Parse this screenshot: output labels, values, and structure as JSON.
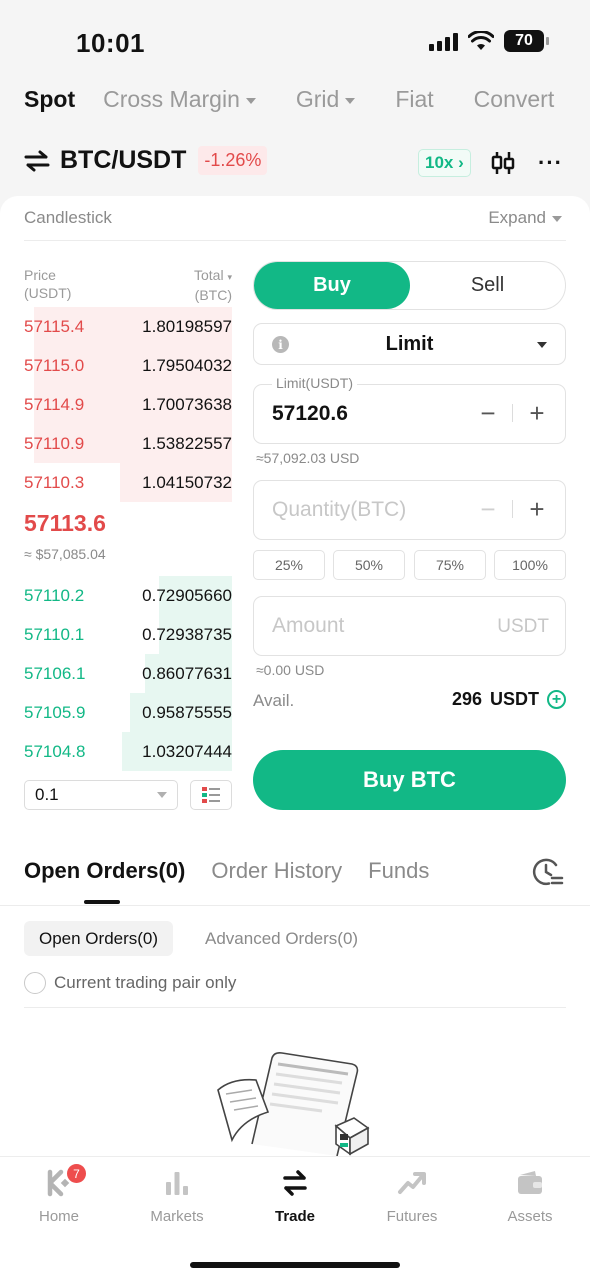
{
  "status_bar": {
    "time": "10:01",
    "battery": "70"
  },
  "trade_types": [
    {
      "label": "Spot"
    },
    {
      "label": "Cross Margin"
    },
    {
      "label": "Grid"
    },
    {
      "label": "Fiat"
    },
    {
      "label": "Convert"
    }
  ],
  "pair": {
    "name": "BTC/USDT",
    "change": "-1.26%",
    "leverage": "10x"
  },
  "chart_section": {
    "label": "Candlestick",
    "expand": "Expand"
  },
  "order_book": {
    "price_header": "Price",
    "price_unit": "(USDT)",
    "total_header": "Total",
    "total_unit": "(BTC)",
    "asks": [
      {
        "price": "57115.4",
        "qty": "1.80198597",
        "depth": 0.95
      },
      {
        "price": "57115.0",
        "qty": "1.79504032",
        "depth": 0.95
      },
      {
        "price": "57114.9",
        "qty": "1.70073638",
        "depth": 0.95
      },
      {
        "price": "57110.9",
        "qty": "1.53822557",
        "depth": 0.95
      },
      {
        "price": "57110.3",
        "qty": "1.04150732",
        "depth": 0.54
      }
    ],
    "mid_price": "57113.6",
    "mid_usd": "≈ $57,085.04",
    "bids": [
      {
        "price": "57110.2",
        "qty": "0.72905660",
        "depth": 0.35
      },
      {
        "price": "57110.1",
        "qty": "0.72938735",
        "depth": 0.35
      },
      {
        "price": "57106.1",
        "qty": "0.86077631",
        "depth": 0.42
      },
      {
        "price": "57105.9",
        "qty": "0.95875555",
        "depth": 0.49
      },
      {
        "price": "57104.8",
        "qty": "1.03207444",
        "depth": 0.53
      }
    ],
    "precision": "0.1"
  },
  "order_form": {
    "buy_label": "Buy",
    "sell_label": "Sell",
    "order_type": "Limit",
    "price_label": "Limit(USDT)",
    "price_value": "57120.6",
    "price_usd": "≈57,092.03 USD",
    "quantity_placeholder": "Quantity(BTC)",
    "percentages": [
      "25%",
      "50%",
      "75%",
      "100%"
    ],
    "amount_placeholder": "Amount",
    "amount_unit": "USDT",
    "amount_usd": "≈0.00 USD",
    "avail_label": "Avail.",
    "avail_value": "296",
    "avail_unit": "USDT",
    "submit_label": "Buy BTC"
  },
  "orders": {
    "tabs": [
      {
        "label": "Open Orders(0)"
      },
      {
        "label": "Order History"
      },
      {
        "label": "Funds"
      }
    ],
    "sub_tabs": [
      {
        "label": "Open Orders(0)"
      },
      {
        "label": "Advanced Orders(0)"
      }
    ],
    "filter_label": "Current trading pair only"
  },
  "bottom_nav": [
    {
      "label": "Home",
      "icon": "kucoin-logo-icon",
      "badge": "7"
    },
    {
      "label": "Markets",
      "icon": "bar-chart-icon"
    },
    {
      "label": "Trade",
      "icon": "swap-arrows-icon"
    },
    {
      "label": "Futures",
      "icon": "trend-arrow-icon"
    },
    {
      "label": "Assets",
      "icon": "wallet-icon"
    }
  ],
  "colors": {
    "buy": "#12b886",
    "sell": "#e24a4a",
    "text": "#121212",
    "muted": "#8a8a8a"
  }
}
